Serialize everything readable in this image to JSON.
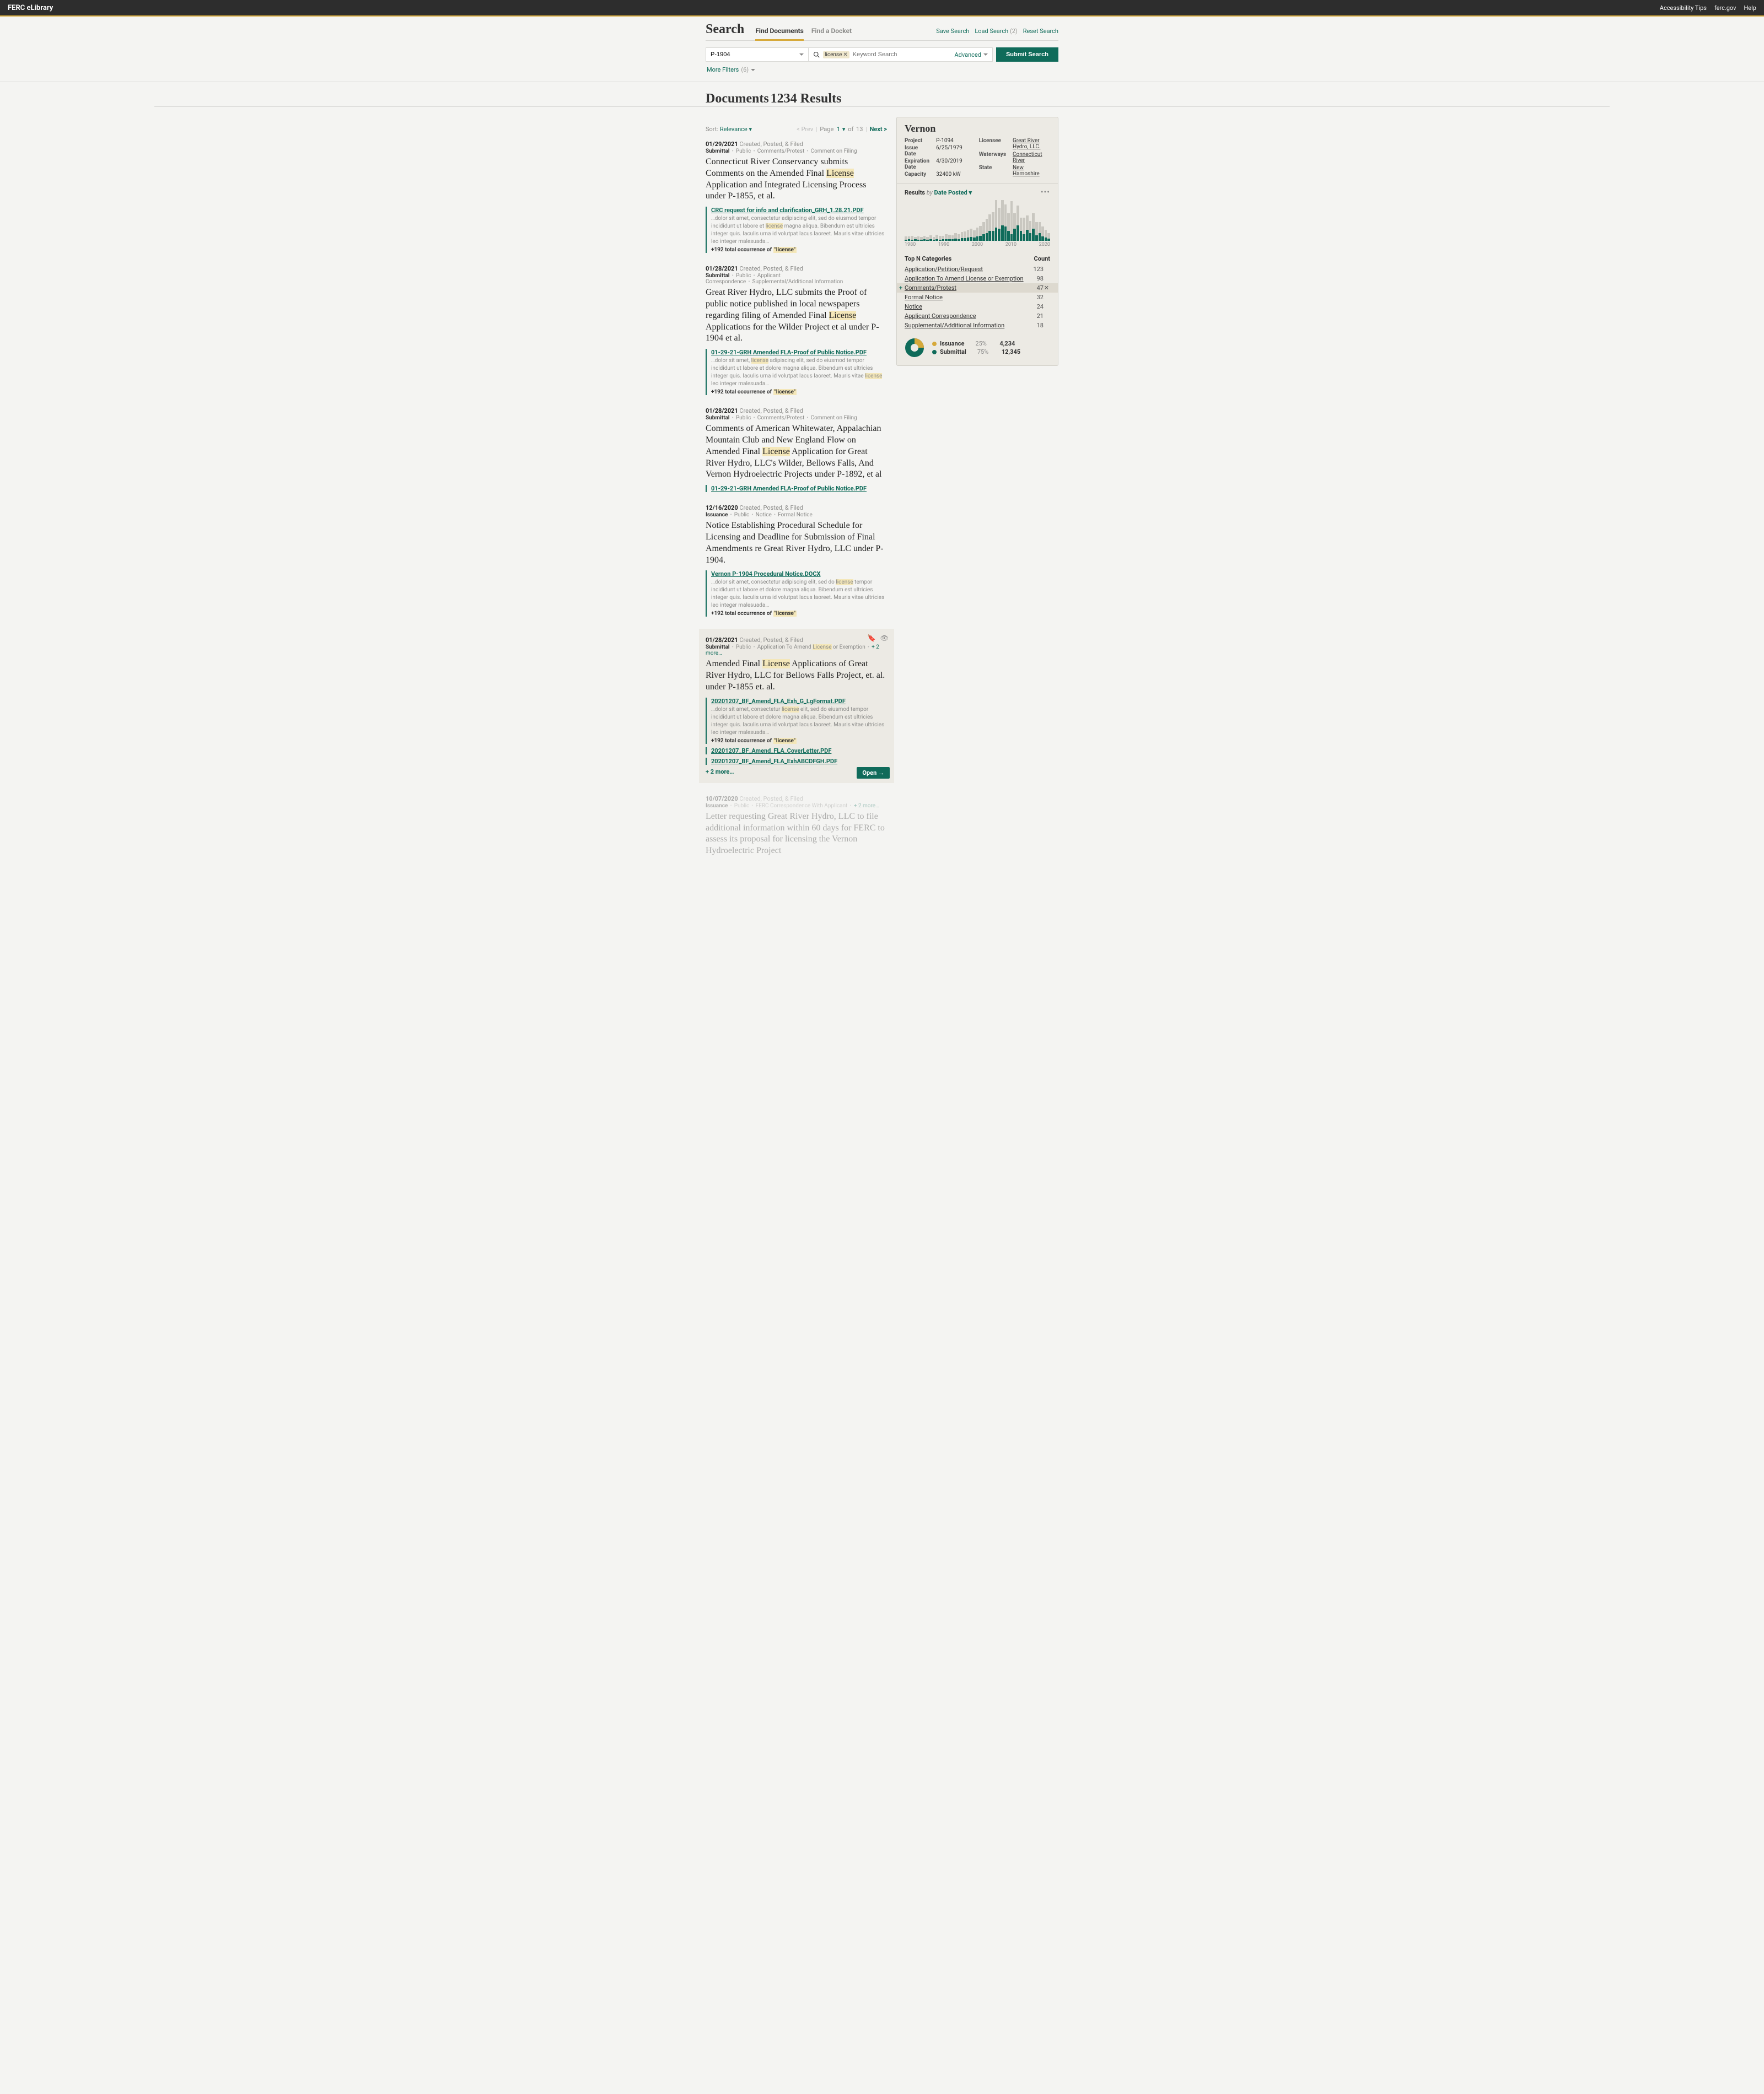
{
  "topbar": {
    "brand": "FERC eLibrary",
    "links": [
      "Accessibility Tips",
      "ferc.gov",
      "Help"
    ]
  },
  "search": {
    "title": "Search",
    "tabs": [
      {
        "label": "Find Documents",
        "active": true
      },
      {
        "label": "Find a Docket",
        "active": false
      }
    ],
    "actions": {
      "save": "Save Search",
      "load": "Load Search",
      "load_count": "(2)",
      "reset": "Reset Search"
    },
    "docket_value": "P-1904",
    "tag": "license",
    "placeholder": "Keyword Search",
    "advanced": "Advanced",
    "submit": "Submit Search",
    "more_filters": "More Filters",
    "more_filters_count": "(6)"
  },
  "documents": {
    "heading": "Documents",
    "count": "1234 Results",
    "sort_label": "Sort:",
    "sort_value": "Relevance",
    "pager": {
      "prev": "< Prev",
      "page_label": "Page",
      "page": "1",
      "of": "of",
      "total": "13",
      "next": "Next >"
    }
  },
  "results": [
    {
      "date": "01/29/2021",
      "status": "Created, Posted, & Filed",
      "meta": [
        "Submittal",
        "Public",
        "Comments/Protest",
        "Comment on Filing"
      ],
      "title_parts": [
        "Connecticut River Conservancy submits Comments on the Amended Final ",
        "License",
        " Application and Integrated Licensing Process under P-1855, et al."
      ],
      "files": [
        {
          "name": "CRC request for info and clarification_GRH_1.28.21.PDF",
          "excerpt_pre": "…dolor sit amet, consectetur adipiscing elit, sed do eiusmod tempor incididunt ut labore et ",
          "excerpt_hl": "license",
          "excerpt_post": " magna aliqua. Bibendum est ultricies integer quis. Iaculis urna id volutpat lacus laoreet. Mauris vitae ultricies leo integer malesuada…",
          "occ": "+192 total occurrence of ",
          "occ_hl": "\"license\""
        }
      ]
    },
    {
      "date": "01/28/2021",
      "status": "Created, Posted, & Filed",
      "meta": [
        "Submittal",
        "Public",
        "Applicant Correspondence",
        "Supplemental/Additional Information"
      ],
      "title_parts": [
        "Great River Hydro, LLC submits the Proof of public notice published in local newspapers regarding filing of Amended Final ",
        "License",
        " Applications for the Wilder Project et al under P-1904 et al."
      ],
      "files": [
        {
          "name": "01-29-21-GRH Amended FLA-Proof of Public Notice.PDF",
          "excerpt_pre": "…dolor sit amet, ",
          "excerpt_hl": "license",
          "excerpt_post": " adipiscing elit, sed do eiusmod tempor incididunt ut labore et dolore magna aliqua. Bibendum est ultricies integer quis. Iaculis urna id volutpat lacus laoreet. Mauris vitae ",
          "excerpt_hl2": "license",
          "excerpt_post2": " leo integer malesuada…",
          "occ": "+192 total occurrence of ",
          "occ_hl": "\"license\""
        }
      ]
    },
    {
      "date": "01/28/2021",
      "status": "Created, Posted, & Filed",
      "meta": [
        "Submittal",
        "Public",
        "Comments/Protest",
        "Comment on Filing"
      ],
      "title_parts": [
        "Comments of American Whitewater, Appalachian Mountain Club and New England Flow on Amended Final ",
        "License",
        " Application for Great River Hydro, LLC's Wilder, Bellows Falls, And Vernon Hydroelectric Projects under P-1892, et al"
      ],
      "files": [
        {
          "name": "01-29-21-GRH Amended FLA-Proof of Public Notice.PDF"
        }
      ]
    },
    {
      "date": "12/16/2020",
      "status": "Created, Posted, & Filed",
      "meta": [
        "Issuance",
        "Public",
        "Notice",
        "Formal Notice"
      ],
      "title_parts": [
        "Notice Establishing Procedural Schedule for Licensing and Deadline for Submission of Final Amendments re Great River Hydro, LLC under P-1904."
      ],
      "files": [
        {
          "name": "Vernon P-1904 Procedural Notice.DOCX",
          "excerpt_pre": "…dolor sit amet, consectetur adipiscing elit, sed do ",
          "excerpt_hl": "license",
          "excerpt_post": " tempor incididunt ut labore et dolore magna aliqua. Bibendum est ultricies integer quis. Iaculis urna id volutpat lacus laoreet. Mauris vitae ultricies leo integer malesuada…",
          "occ": "+192 total occurrence of ",
          "occ_hl": "\"license\""
        }
      ]
    },
    {
      "active": true,
      "date": "01/28/2021",
      "status": "Created, Posted, & Filed",
      "meta_special": {
        "pre": [
          "Submittal",
          "Public"
        ],
        "cat_pre": "Application To Amend ",
        "cat_hl": "License",
        "cat_post": " or Exemption",
        "more": "+ 2 more…"
      },
      "title_parts": [
        "Amended Final ",
        "License",
        " Applications of Great River Hydro, LLC for Bellows Falls Project, et. al. under P-1855 et. al."
      ],
      "files": [
        {
          "name": "20201207_BF_Amend_FLA_Exh_G_LgFormat.PDF",
          "excerpt_pre": "…dolor sit amet, consectetur ",
          "excerpt_hl": "license",
          "excerpt_post": " elit, sed do eiusmod tempor incididunt ut labore et dolore magna aliqua. Bibendum est ultricies integer quis. Iaculis urna id volutpat lacus laoreet. Mauris vitae ultricies leo integer malesuada…",
          "occ": "+192 total occurrence of ",
          "occ_hl": "\"license\""
        },
        {
          "name": "20201207_BF_Amend_FLA_CoverLetter.PDF"
        },
        {
          "name": "20201207_BF_Amend_FLA_ExhABCDFGH.PDF"
        }
      ],
      "more": "+ 2 more…",
      "open": "Open"
    },
    {
      "faded": true,
      "date": "10/07/2020",
      "status": "Created, Posted, & Filed",
      "meta": [
        "Issuance",
        "Public",
        "FERC Correspondence With Applicant"
      ],
      "meta_more": "+ 2 more…",
      "title_parts": [
        "Letter requesting Great River Hydro, LLC to file additional information within 60 days for FERC to assess its proposal for licensing the Vernon Hydroelectric Project"
      ]
    }
  ],
  "panel": {
    "title": "Vernon",
    "left": [
      {
        "k": "Project",
        "v": "P-1094"
      },
      {
        "k": "Issue Date",
        "v": "6/25/1979"
      },
      {
        "k": "Expiration Date",
        "v": "4/30/2019"
      },
      {
        "k": "Capacity",
        "v": "32400 kW"
      }
    ],
    "right": [
      {
        "k": "Licensee",
        "v": "Great River Hydro, LLC.",
        "link": true
      },
      {
        "k": "Waterways",
        "v": "Connecticut River",
        "link": true
      },
      {
        "k": "State",
        "v": "New Hamoshire",
        "link": true
      }
    ],
    "results_by": {
      "label": "Results",
      "by": "by",
      "value": "Date Posted"
    },
    "axis": [
      "1980",
      "1990",
      "2000",
      "2010",
      "2020"
    ],
    "cat_head": {
      "l": "Top N Categories",
      "r": "Count"
    },
    "cats": [
      {
        "name": "Application/Petition/Request",
        "count": "123"
      },
      {
        "name": "Application To Amend License or Exemption",
        "count": "98"
      },
      {
        "name": "Comments/Protest",
        "count": "47",
        "sel": true
      },
      {
        "name": "Formal Notice",
        "count": "32"
      },
      {
        "name": "Notice",
        "count": "24"
      },
      {
        "name": "Applicant Correspondence",
        "count": "21"
      },
      {
        "name": "Supplemental/Additional Information",
        "count": "18"
      }
    ],
    "legend": [
      {
        "color": "y",
        "label": "Issuance",
        "pct": "25%",
        "num": "4,234"
      },
      {
        "color": "t",
        "label": "Submittal",
        "pct": "75%",
        "num": "12,345"
      }
    ]
  },
  "chart_data": {
    "type": "bar",
    "x_range": [
      1978,
      2024
    ],
    "series": [
      {
        "name": "total",
        "color": "#c9c7c0"
      },
      {
        "name": "matching",
        "color": "#0f6b5a"
      }
    ],
    "note": "Heights are visual estimates in pixels from the screenshot; bars stack matching (teal) below remaining total (grey).",
    "bars": [
      {
        "grey": 6,
        "teal": 2
      },
      {
        "grey": 5,
        "teal": 3
      },
      {
        "grey": 7,
        "teal": 2
      },
      {
        "grey": 4,
        "teal": 3
      },
      {
        "grey": 6,
        "teal": 2
      },
      {
        "grey": 5,
        "teal": 2
      },
      {
        "grey": 6,
        "teal": 3
      },
      {
        "grey": 5,
        "teal": 2
      },
      {
        "grey": 7,
        "teal": 3
      },
      {
        "grey": 5,
        "teal": 2
      },
      {
        "grey": 8,
        "teal": 3
      },
      {
        "grey": 7,
        "teal": 2
      },
      {
        "grey": 6,
        "teal": 3
      },
      {
        "grey": 9,
        "teal": 3
      },
      {
        "grey": 8,
        "teal": 3
      },
      {
        "grey": 7,
        "teal": 3
      },
      {
        "grey": 10,
        "teal": 4
      },
      {
        "grey": 9,
        "teal": 3
      },
      {
        "grey": 11,
        "teal": 5
      },
      {
        "grey": 12,
        "teal": 5
      },
      {
        "grey": 14,
        "teal": 6
      },
      {
        "grey": 15,
        "teal": 7
      },
      {
        "grey": 13,
        "teal": 6
      },
      {
        "grey": 16,
        "teal": 8
      },
      {
        "grey": 18,
        "teal": 9
      },
      {
        "grey": 22,
        "teal": 12
      },
      {
        "grey": 26,
        "teal": 14
      },
      {
        "grey": 30,
        "teal": 18
      },
      {
        "grey": 34,
        "teal": 18
      },
      {
        "grey": 50,
        "teal": 24
      },
      {
        "grey": 38,
        "teal": 22
      },
      {
        "grey": 46,
        "teal": 28
      },
      {
        "grey": 40,
        "teal": 26
      },
      {
        "grey": 32,
        "teal": 18
      },
      {
        "grey": 60,
        "teal": 12
      },
      {
        "grey": 28,
        "teal": 22
      },
      {
        "grey": 36,
        "teal": 28
      },
      {
        "grey": 24,
        "teal": 18
      },
      {
        "grey": 30,
        "teal": 12
      },
      {
        "grey": 26,
        "teal": 20
      },
      {
        "grey": 22,
        "teal": 14
      },
      {
        "grey": 28,
        "teal": 22
      },
      {
        "grey": 24,
        "teal": 10
      },
      {
        "grey": 20,
        "teal": 14
      },
      {
        "grey": 18,
        "teal": 8
      },
      {
        "grey": 14,
        "teal": 6
      },
      {
        "grey": 10,
        "teal": 4
      }
    ]
  }
}
